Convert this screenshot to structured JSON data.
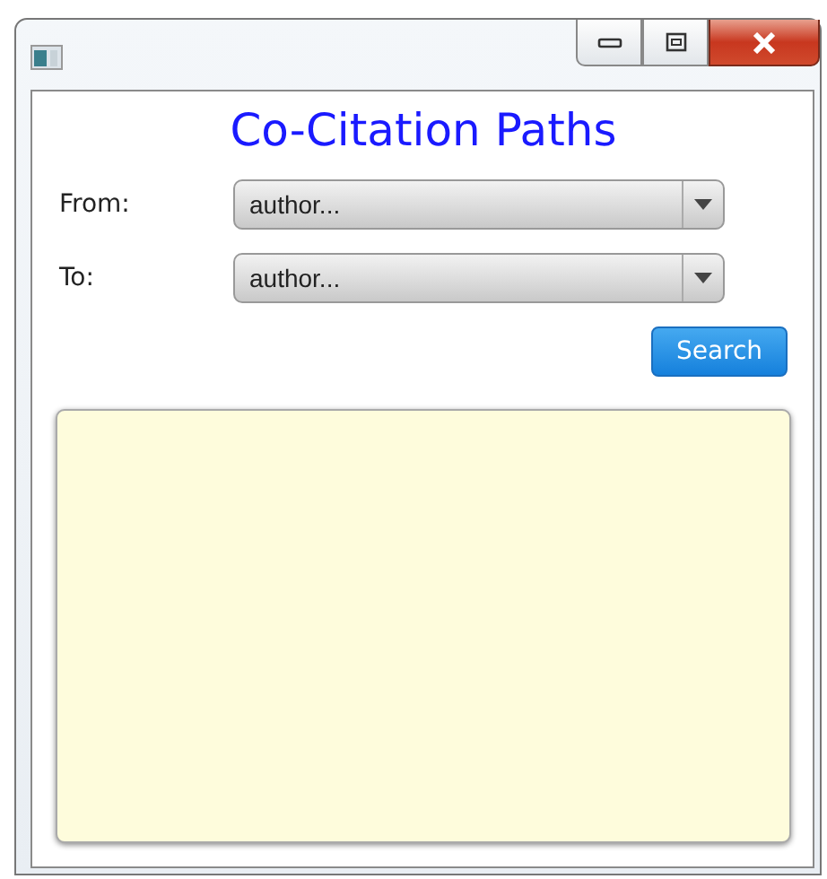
{
  "window": {
    "title_bar_buttons": [
      {
        "kind": "minimize"
      },
      {
        "kind": "maximize"
      },
      {
        "kind": "close"
      }
    ]
  },
  "title": "Co-Citation Paths",
  "fields": [
    {
      "label": "From:",
      "value": "author..."
    },
    {
      "label": "To:",
      "value": "author..."
    }
  ],
  "search_button": "Search",
  "results_area": {
    "kind": "text-area"
  }
}
